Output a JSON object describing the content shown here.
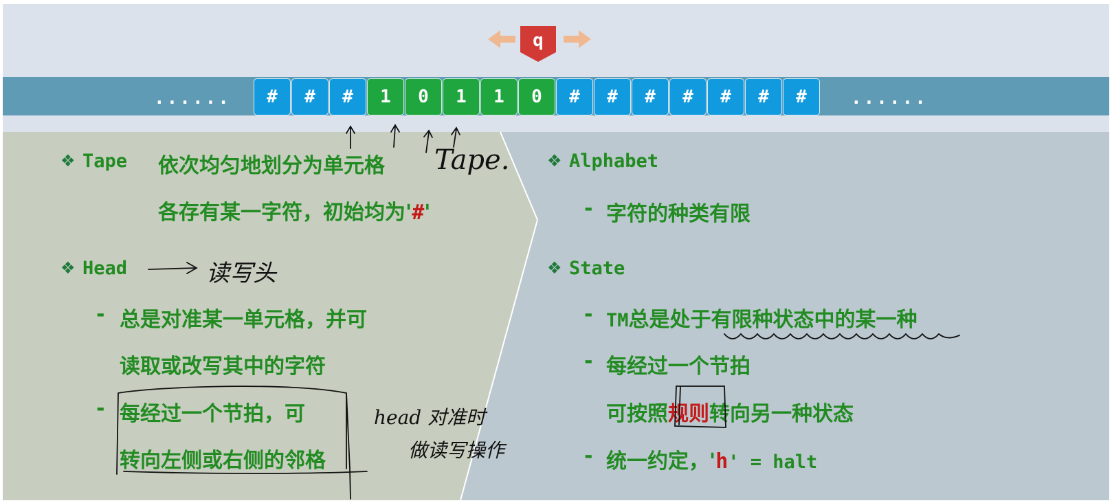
{
  "head": {
    "state_label": "q"
  },
  "tape": {
    "left_ellipsis": "......",
    "right_ellipsis": "......",
    "cells": [
      {
        "symbol": "#",
        "type": "blank"
      },
      {
        "symbol": "#",
        "type": "blank"
      },
      {
        "symbol": "#",
        "type": "blank"
      },
      {
        "symbol": "1",
        "type": "data"
      },
      {
        "symbol": "0",
        "type": "data"
      },
      {
        "symbol": "1",
        "type": "data"
      },
      {
        "symbol": "1",
        "type": "data"
      },
      {
        "symbol": "0",
        "type": "data"
      },
      {
        "symbol": "#",
        "type": "blank"
      },
      {
        "symbol": "#",
        "type": "blank"
      },
      {
        "symbol": "#",
        "type": "blank"
      },
      {
        "symbol": "#",
        "type": "blank"
      },
      {
        "symbol": "#",
        "type": "blank"
      },
      {
        "symbol": "#",
        "type": "blank"
      },
      {
        "symbol": "#",
        "type": "blank"
      }
    ]
  },
  "left": {
    "tape": {
      "title": "Tape",
      "line1": "依次均匀地划分为单元格",
      "line2_pre": "各存有某一字符，初始均为'",
      "line2_hash": "#",
      "line2_post": "'"
    },
    "head": {
      "title": "Head",
      "dash1": "-",
      "item1_line1": "总是对准某一单元格，并可",
      "item1_line2": "读取或改写其中的字符",
      "dash2": "-",
      "item2_line1": "每经过一个节拍，可",
      "item2_line2": "转向左侧或右侧的邻格"
    }
  },
  "right": {
    "alphabet": {
      "title": "Alphabet",
      "dash": "-",
      "item": "字符的种类有限"
    },
    "state": {
      "title": "State",
      "dash1": "-",
      "item1_tm": "TM",
      "item1_rest": "总是处于有限种状态中的某一种",
      "dash2": "-",
      "item2_line1": "每经过一个节拍",
      "item2_pre": "可按照",
      "item2_rule": "规则",
      "item2_post": "转向另一种状态",
      "dash3": "-",
      "item3_pre": "统一约定，'",
      "item3_h": "h",
      "item3_post": "' = halt"
    }
  },
  "handwriting": {
    "tape_note": "Tape.",
    "head_note": "读写头",
    "box_note_line1": "head 对准时",
    "box_note_line2": "做读写操作"
  },
  "colors": {
    "slide_bg": "#dbe2ec",
    "left_panel": "#c7cebf",
    "right_panel": "#bcc8cf",
    "tape_band": "#5f9bb5",
    "blank_cell": "#129adf",
    "data_cell": "#20a63f",
    "text_green": "#228b22",
    "accent_red": "#c41a1a",
    "head_red": "#d23a36",
    "arrow_peach": "#f0b890"
  }
}
